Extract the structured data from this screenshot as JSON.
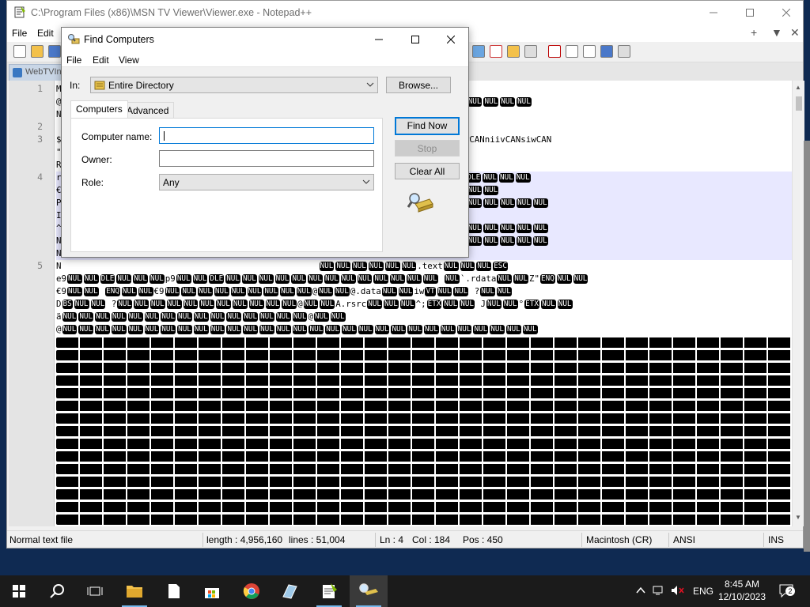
{
  "notepadpp": {
    "title": "C:\\Program Files (x86)\\MSN TV Viewer\\Viewer.exe - Notepad++",
    "menu": [
      "File",
      "Edit"
    ],
    "menu_right": [
      "+",
      "▼",
      "✕"
    ],
    "tab_label": "WebTVIn",
    "line_numbers": [
      "1",
      "2",
      "3",
      "4",
      "5"
    ],
    "status": {
      "file_type": "Normal text file",
      "length": "length : 4,956,160",
      "lines": "lines : 51,004",
      "ln": "Ln : 4",
      "col": "Col : 184",
      "pos": "Pos : 450",
      "eol": "Macintosh (CR)",
      "encoding": "ANSI",
      "mode": "INS"
    }
  },
  "find_dialog": {
    "title": "Find Computers",
    "menu": [
      "File",
      "Edit",
      "View"
    ],
    "in_label": "In:",
    "in_value": "Entire Directory",
    "browse_label": "Browse...",
    "tabs": [
      "Computers",
      "Advanced"
    ],
    "computer_name_label": "Computer name:",
    "computer_name_value": "",
    "owner_label": "Owner:",
    "owner_value": "",
    "role_label": "Role:",
    "role_value": "Any",
    "find_now_label": "Find Now",
    "stop_label": "Stop",
    "clear_all_label": "Clear All"
  },
  "taskbar": {
    "language": "ENG",
    "time": "8:45 AM",
    "date": "12/10/2023",
    "notification_count": "2"
  },
  "colors": {
    "accent": "#0078d7",
    "desktop": "#0f2a52",
    "taskbar": "#1b1b1b"
  }
}
